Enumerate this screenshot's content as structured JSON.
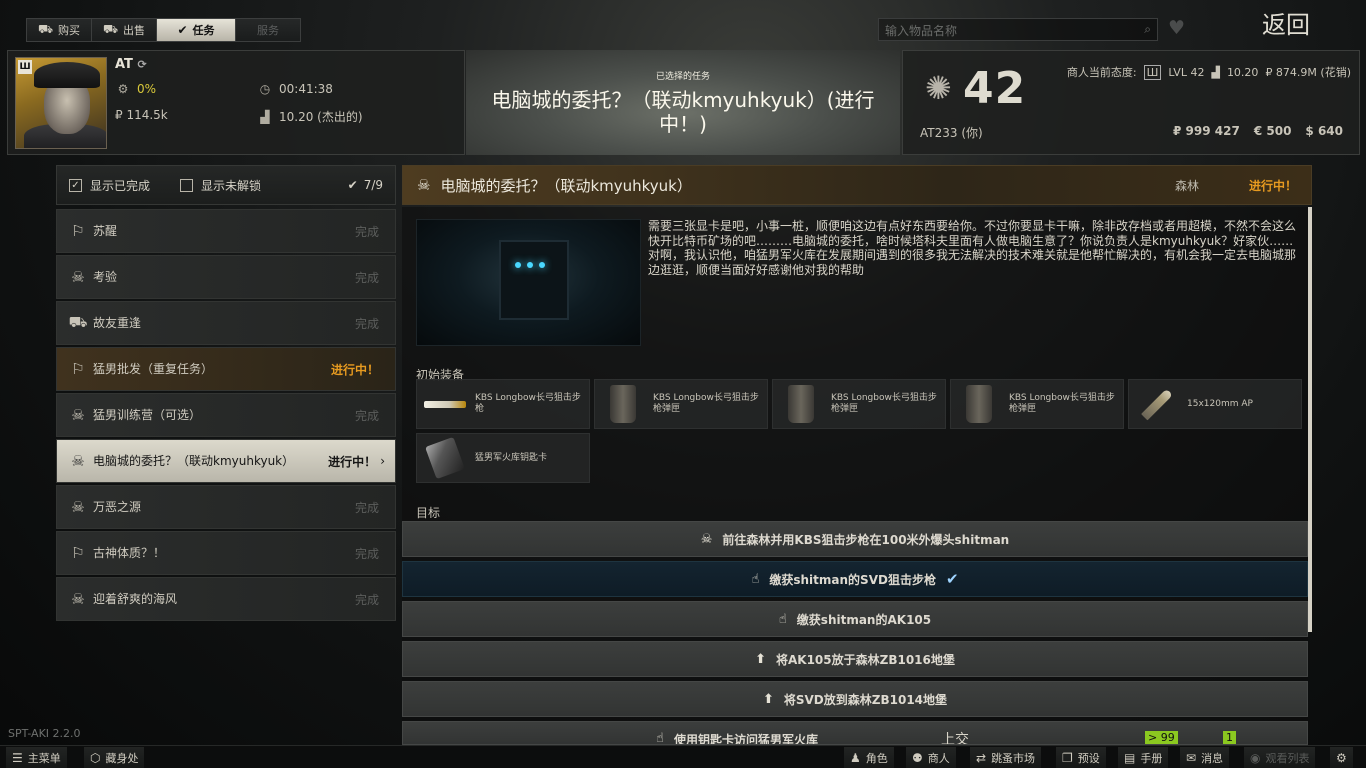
{
  "top_tabs": [
    {
      "label": "购买",
      "icon": "cart-icon"
    },
    {
      "label": "出售",
      "icon": "sell-icon"
    },
    {
      "label": "任务",
      "icon": "task-check-icon"
    },
    {
      "label": "服务",
      "icon": ""
    }
  ],
  "search": {
    "placeholder": "输入物品名称"
  },
  "back_label": "返回",
  "trader": {
    "rank_badge": "Ш",
    "name": "AT",
    "rep_percent": "0%",
    "timer": "00:41:38",
    "sales": "₽ 114.5k",
    "standing": "10.20 (杰出的)"
  },
  "selected_task": {
    "label": "已选择的任务",
    "title": "电脑城的委托？（联动kmyuhkyuk）(进行中！)"
  },
  "player": {
    "level": "42",
    "name": "AT233 (你)",
    "standing_label": "商人当前态度:",
    "lvl": "LVL 42",
    "rep": "10.20",
    "spent": "₽ 874.9M (花销)",
    "rub": "₽ 999 427",
    "eur": "€ 500",
    "usd": "$ 640"
  },
  "filters": {
    "show_completed": "显示已完成",
    "show_locked": "显示未解锁",
    "count": "7/9"
  },
  "quests": [
    {
      "name": "苏醒",
      "status": "完成",
      "icon": "run-icon",
      "state": "done"
    },
    {
      "name": "考验",
      "status": "完成",
      "icon": "skull-icon",
      "state": "done"
    },
    {
      "name": "故友重逢",
      "status": "完成",
      "icon": "cart-icon",
      "state": "done"
    },
    {
      "name": "猛男批发（重复任务）",
      "status": "进行中！",
      "icon": "run-icon",
      "state": "progress"
    },
    {
      "name": "猛男训练营（可选）",
      "status": "完成",
      "icon": "skull-icon",
      "state": "done"
    },
    {
      "name": "电脑城的委托？（联动kmyuhkyuk）",
      "status": "进行中！",
      "icon": "skull-icon",
      "state": "selected"
    },
    {
      "name": "万恶之源",
      "status": "完成",
      "icon": "skull-icon",
      "state": "done"
    },
    {
      "name": "古神体质？！",
      "status": "完成",
      "icon": "run-icon",
      "state": "done"
    },
    {
      "name": "迎着舒爽的海风",
      "status": "完成",
      "icon": "skull-icon",
      "state": "done"
    }
  ],
  "detail": {
    "title": "电脑城的委托？（联动kmyuhkyuk）",
    "location": "森林",
    "status": "进行中！",
    "description": "需要三张显卡是吧，小事一桩，顺便咱这边有点好东西要给你。不过你要显卡干嘛，除非改存档或者用超模，不然不会这么快开比特币矿场的吧………电脑城的委托，啥时候塔科夫里面有人做电脑生意了？你说负责人是kmyuhkyuk？好家伙……对啊，我认识他，咱猛男军火库在发展期间遇到的很多我无法解决的技术难关就是他帮忙解决的，有机会我一定去电脑城那边逛逛，顺便当面好好感谢他对我的帮助",
    "starting_label": "初始装备",
    "items": [
      {
        "name": "KBS Longbow长弓狙击步枪",
        "thumb": "rifle"
      },
      {
        "name": "KBS Longbow长弓狙击步枪弹匣",
        "thumb": "mag"
      },
      {
        "name": "KBS Longbow长弓狙击步枪弹匣",
        "thumb": "mag"
      },
      {
        "name": "KBS Longbow长弓狙击步枪弹匣",
        "thumb": "mag"
      },
      {
        "name": "15x120mm AP",
        "thumb": "ammo"
      },
      {
        "name": "猛男军火库钥匙卡",
        "thumb": "keycard"
      }
    ],
    "objectives_label": "目标",
    "objectives": [
      {
        "text": "前往森林并用KBS狙击步枪在100米外爆头shitman",
        "icon": "skull-icon",
        "done": false
      },
      {
        "text": "缴获shitman的SVD狙击步枪",
        "icon": "hand-icon",
        "done": true
      },
      {
        "text": "缴获shitman的AK105",
        "icon": "hand-icon",
        "done": false
      },
      {
        "text": "将AK105放于森林ZB1016地堡",
        "icon": "arrow-up-icon",
        "done": false
      },
      {
        "text": "将SVD放到森林ZB1014地堡",
        "icon": "arrow-up-icon",
        "done": false
      },
      {
        "text": "使用钥匙卡访问猛男军火库",
        "icon": "hand-icon",
        "done": false,
        "turnin": "上交",
        "badge1": "> 99",
        "badge2": "1"
      }
    ]
  },
  "version": "SPT-AKI 2.2.0",
  "bottom_left": [
    {
      "label": "主菜单",
      "icon": "menu-icon"
    },
    {
      "label": "藏身处",
      "icon": "hideout-icon"
    }
  ],
  "bottom_right": [
    {
      "label": "角色",
      "icon": "character-icon"
    },
    {
      "label": "商人",
      "icon": "traders-icon"
    },
    {
      "label": "跳蚤市场",
      "icon": "flea-market-icon"
    },
    {
      "label": "预设",
      "icon": "presets-icon"
    },
    {
      "label": "手册",
      "icon": "handbook-icon"
    },
    {
      "label": "消息",
      "icon": "messages-icon"
    },
    {
      "label": "观看列表",
      "icon": "watchlist-icon"
    }
  ],
  "colors": {
    "progress": "#e69a20",
    "accent_green": "#8bc820",
    "check": "#9fd4ff"
  }
}
